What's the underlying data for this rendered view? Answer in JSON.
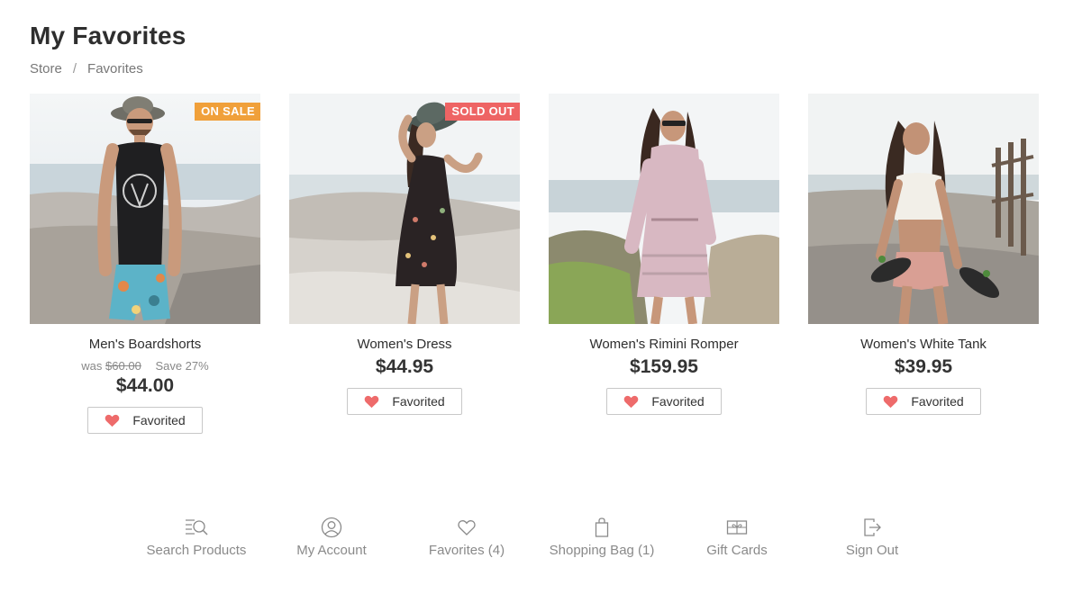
{
  "page": {
    "title": "My Favorites"
  },
  "breadcrumb": {
    "items": [
      "Store",
      "Favorites"
    ],
    "separator": "/"
  },
  "products": [
    {
      "name": "Men's Boardshorts",
      "badge": "ON SALE",
      "was_label": "was",
      "was_price": "$60.00",
      "save_text": "Save 27%",
      "price": "$44.00",
      "favorite_label": "Favorited"
    },
    {
      "name": "Women's Dress",
      "badge": "SOLD OUT",
      "price": "$44.95",
      "favorite_label": "Favorited"
    },
    {
      "name": "Women's Rimini Romper",
      "price": "$159.95",
      "favorite_label": "Favorited"
    },
    {
      "name": "Women's White Tank",
      "price": "$39.95",
      "favorite_label": "Favorited"
    }
  ],
  "bottom_nav": [
    {
      "label": "Search Products",
      "icon": "search-list-icon"
    },
    {
      "label": "My Account",
      "icon": "user-circle-icon"
    },
    {
      "label": "Favorites (4)",
      "icon": "heart-outline-icon"
    },
    {
      "label": "Shopping Bag (1)",
      "icon": "shopping-bag-icon"
    },
    {
      "label": "Gift Cards",
      "icon": "gift-card-icon"
    },
    {
      "label": "Sign Out",
      "icon": "sign-out-icon"
    }
  ],
  "colors": {
    "sale_badge": "#f0a03a",
    "soldout_badge": "#ee6464",
    "heart": "#ee6b6b",
    "nav_text": "#8a8a8a"
  }
}
